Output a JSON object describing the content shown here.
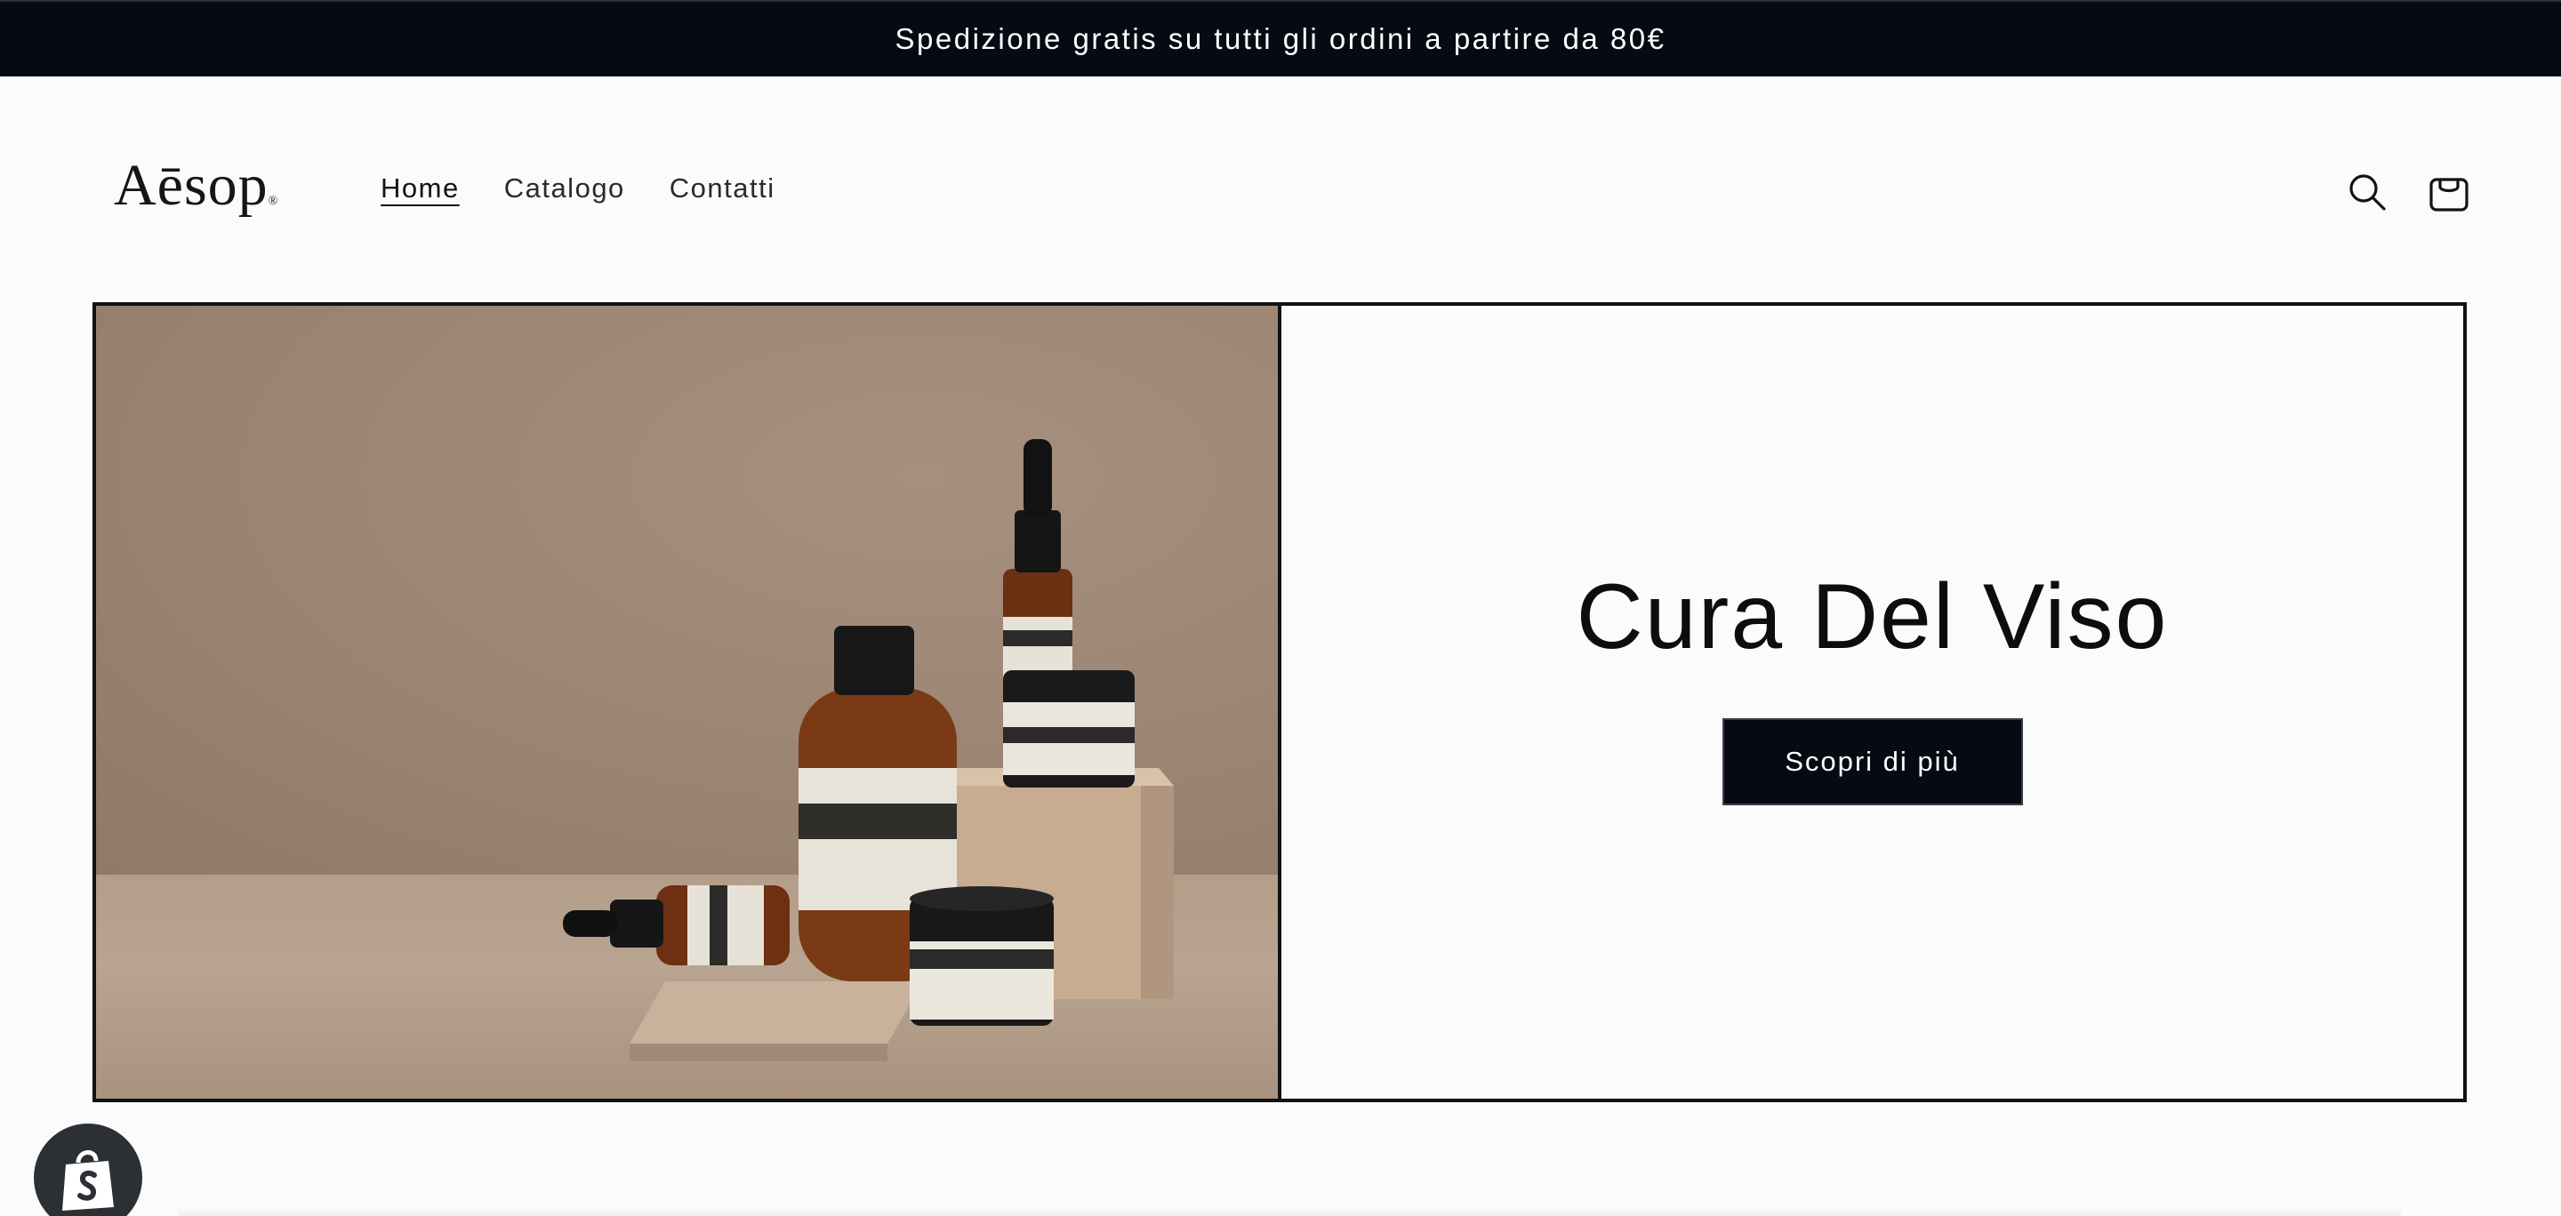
{
  "announcement": {
    "text": "Spedizione gratis su tutti gli ordini a partire da 80€"
  },
  "header": {
    "logo_text": "Aēsop",
    "logo_mark": "®",
    "nav": [
      {
        "label": "Home",
        "active": true
      },
      {
        "label": "Catalogo",
        "active": false
      },
      {
        "label": "Contatti",
        "active": false
      }
    ],
    "icons": [
      "search-icon",
      "cart-icon"
    ]
  },
  "hero": {
    "title": "Cura Del Viso",
    "button_label": "Scopri di più",
    "image_alt_icon": "product-photo"
  },
  "badge": {
    "icon": "shopify-bag-icon"
  },
  "colors": {
    "announcement_bg": "#060b13",
    "button_bg": "#060b13",
    "page_bg": "#fbfbfb",
    "text": "#121212"
  }
}
